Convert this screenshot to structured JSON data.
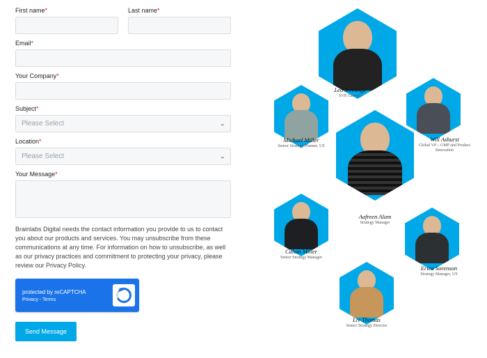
{
  "form": {
    "firstName": {
      "label": "First name"
    },
    "lastName": {
      "label": "Last name"
    },
    "email": {
      "label": "Email"
    },
    "company": {
      "label": "Your Company"
    },
    "subject": {
      "label": "Subject",
      "placeholder": "Please Select"
    },
    "location": {
      "label": "Location",
      "placeholder": "Please Select"
    },
    "message": {
      "label": "Your Message"
    },
    "privacy": "Brainlabs Digital needs the contact information you provide to us to contact you about our products and services. You may unsubscribe from these communications at any time. For information on how to unsubscribe, as well as our privacy practices and commitment to protecting your privacy, please review our Privacy Policy.",
    "recaptcha": {
      "line1": "protected by reCAPTCHA",
      "line2": "Privacy - Terms"
    },
    "submit": "Send Message"
  },
  "team": [
    {
      "name": "Leo Jennings",
      "role": "SVP, Growth"
    },
    {
      "name": "Michael Miller",
      "role": "Senior Strategy Planner, US"
    },
    {
      "name": "Will Ashurst",
      "role": "Global VP – GMP and Product Innovation"
    },
    {
      "name": "Aafreen Alam",
      "role": "Strategy Manager"
    },
    {
      "name": "Calum Miller",
      "role": "Senior Strategy Manager"
    },
    {
      "name": "Erica Sorenson",
      "role": "Strategy Manager, US"
    },
    {
      "name": "Liv Thomas",
      "role": "Senior Strategy Director"
    }
  ]
}
